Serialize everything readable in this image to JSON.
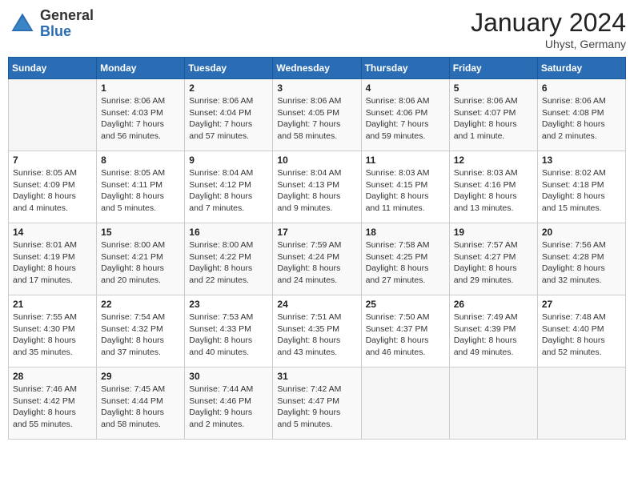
{
  "header": {
    "logo_line1": "General",
    "logo_line2": "Blue",
    "month_year": "January 2024",
    "location": "Uhyst, Germany"
  },
  "days_of_week": [
    "Sunday",
    "Monday",
    "Tuesday",
    "Wednesday",
    "Thursday",
    "Friday",
    "Saturday"
  ],
  "weeks": [
    [
      {
        "day": "",
        "sunrise": "",
        "sunset": "",
        "daylight": ""
      },
      {
        "day": "1",
        "sunrise": "Sunrise: 8:06 AM",
        "sunset": "Sunset: 4:03 PM",
        "daylight": "Daylight: 7 hours and 56 minutes."
      },
      {
        "day": "2",
        "sunrise": "Sunrise: 8:06 AM",
        "sunset": "Sunset: 4:04 PM",
        "daylight": "Daylight: 7 hours and 57 minutes."
      },
      {
        "day": "3",
        "sunrise": "Sunrise: 8:06 AM",
        "sunset": "Sunset: 4:05 PM",
        "daylight": "Daylight: 7 hours and 58 minutes."
      },
      {
        "day": "4",
        "sunrise": "Sunrise: 8:06 AM",
        "sunset": "Sunset: 4:06 PM",
        "daylight": "Daylight: 7 hours and 59 minutes."
      },
      {
        "day": "5",
        "sunrise": "Sunrise: 8:06 AM",
        "sunset": "Sunset: 4:07 PM",
        "daylight": "Daylight: 8 hours and 1 minute."
      },
      {
        "day": "6",
        "sunrise": "Sunrise: 8:06 AM",
        "sunset": "Sunset: 4:08 PM",
        "daylight": "Daylight: 8 hours and 2 minutes."
      }
    ],
    [
      {
        "day": "7",
        "sunrise": "Sunrise: 8:05 AM",
        "sunset": "Sunset: 4:09 PM",
        "daylight": "Daylight: 8 hours and 4 minutes."
      },
      {
        "day": "8",
        "sunrise": "Sunrise: 8:05 AM",
        "sunset": "Sunset: 4:11 PM",
        "daylight": "Daylight: 8 hours and 5 minutes."
      },
      {
        "day": "9",
        "sunrise": "Sunrise: 8:04 AM",
        "sunset": "Sunset: 4:12 PM",
        "daylight": "Daylight: 8 hours and 7 minutes."
      },
      {
        "day": "10",
        "sunrise": "Sunrise: 8:04 AM",
        "sunset": "Sunset: 4:13 PM",
        "daylight": "Daylight: 8 hours and 9 minutes."
      },
      {
        "day": "11",
        "sunrise": "Sunrise: 8:03 AM",
        "sunset": "Sunset: 4:15 PM",
        "daylight": "Daylight: 8 hours and 11 minutes."
      },
      {
        "day": "12",
        "sunrise": "Sunrise: 8:03 AM",
        "sunset": "Sunset: 4:16 PM",
        "daylight": "Daylight: 8 hours and 13 minutes."
      },
      {
        "day": "13",
        "sunrise": "Sunrise: 8:02 AM",
        "sunset": "Sunset: 4:18 PM",
        "daylight": "Daylight: 8 hours and 15 minutes."
      }
    ],
    [
      {
        "day": "14",
        "sunrise": "Sunrise: 8:01 AM",
        "sunset": "Sunset: 4:19 PM",
        "daylight": "Daylight: 8 hours and 17 minutes."
      },
      {
        "day": "15",
        "sunrise": "Sunrise: 8:00 AM",
        "sunset": "Sunset: 4:21 PM",
        "daylight": "Daylight: 8 hours and 20 minutes."
      },
      {
        "day": "16",
        "sunrise": "Sunrise: 8:00 AM",
        "sunset": "Sunset: 4:22 PM",
        "daylight": "Daylight: 8 hours and 22 minutes."
      },
      {
        "day": "17",
        "sunrise": "Sunrise: 7:59 AM",
        "sunset": "Sunset: 4:24 PM",
        "daylight": "Daylight: 8 hours and 24 minutes."
      },
      {
        "day": "18",
        "sunrise": "Sunrise: 7:58 AM",
        "sunset": "Sunset: 4:25 PM",
        "daylight": "Daylight: 8 hours and 27 minutes."
      },
      {
        "day": "19",
        "sunrise": "Sunrise: 7:57 AM",
        "sunset": "Sunset: 4:27 PM",
        "daylight": "Daylight: 8 hours and 29 minutes."
      },
      {
        "day": "20",
        "sunrise": "Sunrise: 7:56 AM",
        "sunset": "Sunset: 4:28 PM",
        "daylight": "Daylight: 8 hours and 32 minutes."
      }
    ],
    [
      {
        "day": "21",
        "sunrise": "Sunrise: 7:55 AM",
        "sunset": "Sunset: 4:30 PM",
        "daylight": "Daylight: 8 hours and 35 minutes."
      },
      {
        "day": "22",
        "sunrise": "Sunrise: 7:54 AM",
        "sunset": "Sunset: 4:32 PM",
        "daylight": "Daylight: 8 hours and 37 minutes."
      },
      {
        "day": "23",
        "sunrise": "Sunrise: 7:53 AM",
        "sunset": "Sunset: 4:33 PM",
        "daylight": "Daylight: 8 hours and 40 minutes."
      },
      {
        "day": "24",
        "sunrise": "Sunrise: 7:51 AM",
        "sunset": "Sunset: 4:35 PM",
        "daylight": "Daylight: 8 hours and 43 minutes."
      },
      {
        "day": "25",
        "sunrise": "Sunrise: 7:50 AM",
        "sunset": "Sunset: 4:37 PM",
        "daylight": "Daylight: 8 hours and 46 minutes."
      },
      {
        "day": "26",
        "sunrise": "Sunrise: 7:49 AM",
        "sunset": "Sunset: 4:39 PM",
        "daylight": "Daylight: 8 hours and 49 minutes."
      },
      {
        "day": "27",
        "sunrise": "Sunrise: 7:48 AM",
        "sunset": "Sunset: 4:40 PM",
        "daylight": "Daylight: 8 hours and 52 minutes."
      }
    ],
    [
      {
        "day": "28",
        "sunrise": "Sunrise: 7:46 AM",
        "sunset": "Sunset: 4:42 PM",
        "daylight": "Daylight: 8 hours and 55 minutes."
      },
      {
        "day": "29",
        "sunrise": "Sunrise: 7:45 AM",
        "sunset": "Sunset: 4:44 PM",
        "daylight": "Daylight: 8 hours and 58 minutes."
      },
      {
        "day": "30",
        "sunrise": "Sunrise: 7:44 AM",
        "sunset": "Sunset: 4:46 PM",
        "daylight": "Daylight: 9 hours and 2 minutes."
      },
      {
        "day": "31",
        "sunrise": "Sunrise: 7:42 AM",
        "sunset": "Sunset: 4:47 PM",
        "daylight": "Daylight: 9 hours and 5 minutes."
      },
      {
        "day": "",
        "sunrise": "",
        "sunset": "",
        "daylight": ""
      },
      {
        "day": "",
        "sunrise": "",
        "sunset": "",
        "daylight": ""
      },
      {
        "day": "",
        "sunrise": "",
        "sunset": "",
        "daylight": ""
      }
    ]
  ]
}
